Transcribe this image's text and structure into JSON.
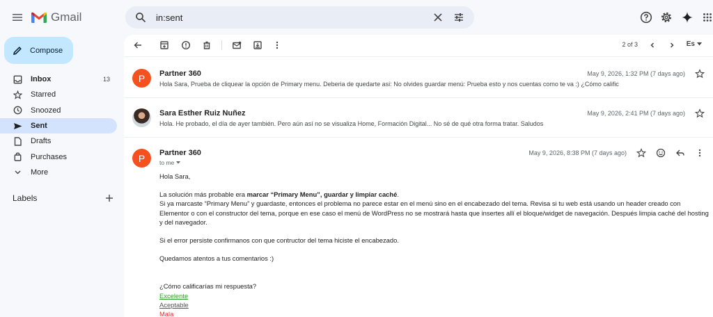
{
  "header": {
    "app_name": "Gmail",
    "search_query": "in:sent"
  },
  "sidebar": {
    "compose_label": "Compose",
    "items": [
      {
        "label": "Inbox",
        "count": "13",
        "icon": "inbox-icon"
      },
      {
        "label": "Starred",
        "icon": "star-icon"
      },
      {
        "label": "Snoozed",
        "icon": "clock-icon"
      },
      {
        "label": "Sent",
        "icon": "send-icon"
      },
      {
        "label": "Drafts",
        "icon": "draft-icon"
      },
      {
        "label": "Purchases",
        "icon": "purchases-icon"
      },
      {
        "label": "More",
        "icon": "chevron-down-icon"
      }
    ],
    "labels_title": "Labels"
  },
  "toolbar": {
    "pager": "2 of 3",
    "language": "Es"
  },
  "thread": [
    {
      "sender": "Partner 360",
      "avatar_letter": "P",
      "date": "May 9, 2026, 1:32 PM (7 days ago)",
      "snippet": "Hola Sara, Prueba de cliquear la opción de Primary menu. Deberia de quedarte asi: No olvides guardar menú: Prueba esto y nos cuentas como te va :) ¿Cómo calific"
    },
    {
      "sender": "Sara Esther Ruiz Nuñez",
      "date": "May 9, 2026, 2:41 PM (7 days ago)",
      "snippet": "Hola. He probado, el día de ayer también. Pero aún así no se visualiza Home, Formación Digital... No sé de qué otra forma tratar. Saludos"
    },
    {
      "sender": "Partner 360",
      "avatar_letter": "P",
      "date": "May 9, 2026, 8:38 PM (7 days ago)",
      "to": "to me",
      "body": {
        "greeting": "Hola Sara,",
        "p1_prefix": "La solución más probable era ",
        "p1_bold": "marcar “Primary Menu”, guardar y limpiar caché",
        "p1_suffix": ".",
        "p2": "Si ya marcaste “Primary Menu” y guardaste, entonces el problema no parece estar en el menú sino en el encabezado del tema. Revisa si tu web está usando un header creado con Elementor o con el constructor del tema, porque en ese caso el menú de WordPress no se mostrará hasta que insertes allí el bloque/widget de navegación. Después limpia caché del hosting y del navegador.",
        "p3": "Si el error persiste confirmanos con que contructor del tema hiciste el encabezado.",
        "p4": "Quedamos atentos a tus comentarios :)",
        "rating_question": "¿Cómo calificarías mi respuesta?",
        "rating_good": "Excelente",
        "rating_ok": "Aceptable",
        "rating_bad": "Mala"
      }
    }
  ]
}
